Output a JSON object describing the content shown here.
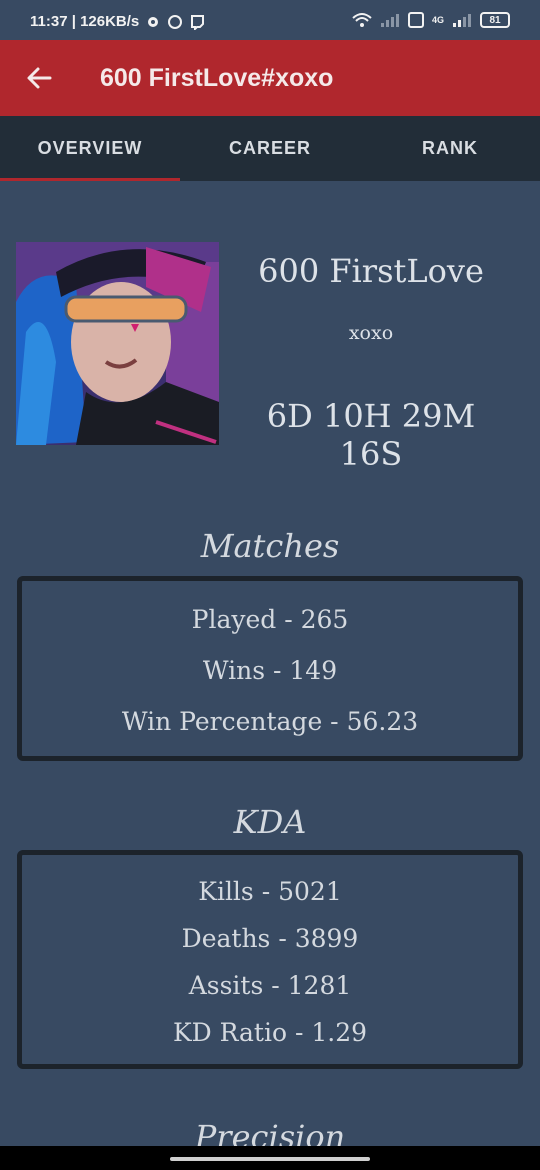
{
  "status_bar": {
    "time_speed": "11:37 | 126KB/s",
    "network_label": "4G",
    "battery": "81"
  },
  "appbar": {
    "title": "600 FirstLove#xoxo"
  },
  "tabs": [
    {
      "label": "OVERVIEW",
      "active": true
    },
    {
      "label": "CAREER",
      "active": false
    },
    {
      "label": "RANK",
      "active": false
    }
  ],
  "profile": {
    "name": "600 FirstLove",
    "tag": "xoxo",
    "time_played": "6D 10H 29M 16S"
  },
  "matches": {
    "title": "Matches",
    "lines": [
      "Played - 265",
      "Wins - 149",
      "Win Percentage - 56.23"
    ]
  },
  "kda": {
    "title": "KDA",
    "lines": [
      "Kills - 5021",
      "Deaths - 3899",
      "Assits - 1281",
      "KD Ratio - 1.29"
    ]
  },
  "precision": {
    "title": "Precision"
  },
  "colors": {
    "accent": "#b0272d",
    "background": "#384a62",
    "tab_bar": "#222d38",
    "box_border": "#1c232b"
  }
}
